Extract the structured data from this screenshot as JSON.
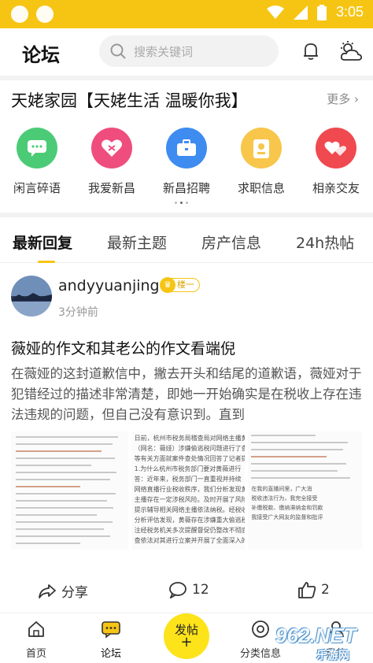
{
  "status_bar": {
    "time": "3:05",
    "accent": "#f6c514"
  },
  "header": {
    "title": "论坛",
    "search_placeholder": "搜索关键词"
  },
  "community": {
    "title": "天姥家园【天姥生活 温暖你我】",
    "more": "更多",
    "items": [
      {
        "label": "闲言碎语",
        "icon": "chat-icon",
        "color": "#4ccb76"
      },
      {
        "label": "我爱新昌",
        "icon": "heart-icon",
        "color": "#ef4d7d"
      },
      {
        "label": "新昌招聘",
        "icon": "briefcase-icon",
        "color": "#3e8cf0"
      },
      {
        "label": "求职信息",
        "icon": "badge-icon",
        "color": "#f7c64a"
      },
      {
        "label": "相亲交友",
        "icon": "hearts-icon",
        "color": "#f0494f"
      }
    ]
  },
  "tabs": [
    {
      "label": "最新回复",
      "active": true
    },
    {
      "label": "最新主题",
      "active": false
    },
    {
      "label": "房产信息",
      "active": false
    },
    {
      "label": "24h热帖",
      "active": false
    }
  ],
  "post": {
    "username": "andyyuanjing",
    "badge": "楼一",
    "time": "3分钟前",
    "title": "薇娅的作文和其老公的作文看端倪",
    "body": "在薇娅的这封道歉信中，撇去开头和结尾的道歉语，薇娅对于犯错经过的描述非常清楚，即她一开始确实是在税收上存在违法违规的问题，但自己没有意识到。直到",
    "image_text": {
      "middle": [
        "日前，杭州市税务局稽查局对网络主播黄",
        "（网名：薇娅）涉嫌偷逃税问题进行了查处。",
        "等有关方面就案件查处情况回答了记者提问。",
        "1.为什么杭州市税务部门要对黄薇进行",
        "答：近年来，税务部门一直重视并持续",
        "网络直播行业税收秩序，我们分析发现黄薇",
        "主播存在一定涉税风险。及时开展了风险核查",
        "提示辅导相关网络主播依法纳税。经税收大",
        "分析评估发现，黄薇存在涉嫌重大偷逃税问",
        "注经税务机关多次提醒督促仍整改不彻底",
        "查依法对其进行立案并开展了全面深入的税务"
      ],
      "right": [
        "在我的直播间里，广大消",
        "税收违法行为，我完全接受",
        "补缴税款、缴纳滞纳金和罚款",
        "我接受广大网友的监督和批评"
      ]
    },
    "share_label": "分享",
    "comments": "12",
    "likes": "2"
  },
  "bottom_nav": [
    {
      "label": "首页",
      "icon": "home-icon"
    },
    {
      "label": "论坛",
      "icon": "forum-icon"
    },
    {
      "label": "分类信息",
      "icon": "category-icon"
    },
    {
      "label": "我的",
      "icon": "profile-icon"
    }
  ],
  "post_button": {
    "label": "发帖",
    "plus": "+"
  },
  "watermark": {
    "text": "962.NET",
    "subtext": "乐游网"
  }
}
